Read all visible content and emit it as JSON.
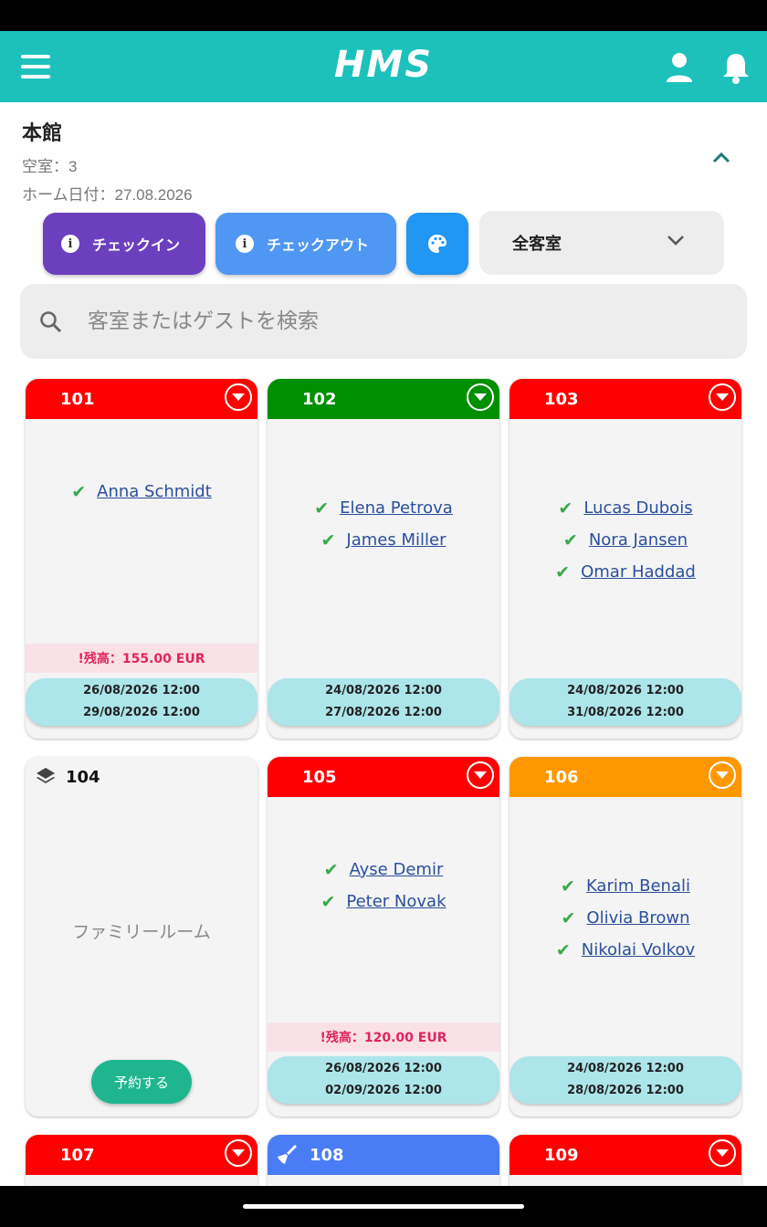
{
  "app": {
    "title": "HMS"
  },
  "header": {
    "building": "本館",
    "vacant": "空室：3",
    "home_date": "ホーム日付：27.08.2026"
  },
  "toolbar": {
    "checkin_label": "チェックイン",
    "checkout_label": "チェックアウト",
    "filter_selected": "全客室"
  },
  "search": {
    "placeholder": "客室またはゲストを検索"
  },
  "colors": {
    "accent": "#1cc1bb",
    "occupied": "#ff0000",
    "arriving": "#008f00",
    "departing": "#ff9800",
    "cleaning": "#4a7cf6"
  },
  "rooms": [
    {
      "number": "101",
      "status_color": "#ff0000",
      "guests": [
        "Anna Schmidt"
      ],
      "balance": "!残高：155.00 EUR",
      "checkin": "26/08/2026 12:00",
      "checkout": "29/08/2026 12:00"
    },
    {
      "number": "102",
      "status_color": "#008f00",
      "guests": [
        "Elena Petrova",
        "James Miller"
      ],
      "checkin": "24/08/2026 12:00",
      "checkout": "27/08/2026 12:00"
    },
    {
      "number": "103",
      "status_color": "#ff0000",
      "guests": [
        "Lucas Dubois",
        "Nora Jansen",
        "Omar Haddad"
      ],
      "checkin": "24/08/2026 12:00",
      "checkout": "31/08/2026 12:00"
    },
    {
      "number": "104",
      "vacant": true,
      "room_type": "ファミリールーム",
      "book_label": "予約する"
    },
    {
      "number": "105",
      "status_color": "#ff0000",
      "guests": [
        "Ayse Demir",
        "Peter Novak"
      ],
      "balance": "!残高：120.00 EUR",
      "checkin": "26/08/2026 12:00",
      "checkout": "02/09/2026 12:00"
    },
    {
      "number": "106",
      "status_color": "#ff9800",
      "guests": [
        "Karim Benali",
        "Olivia Brown",
        "Nikolai Volkov"
      ],
      "checkin": "24/08/2026 12:00",
      "checkout": "28/08/2026 12:00"
    },
    {
      "number": "107",
      "status_color": "#ff0000"
    },
    {
      "number": "108",
      "status_color": "#4a7cf6",
      "cleaning": true
    },
    {
      "number": "109",
      "status_color": "#ff0000"
    }
  ]
}
